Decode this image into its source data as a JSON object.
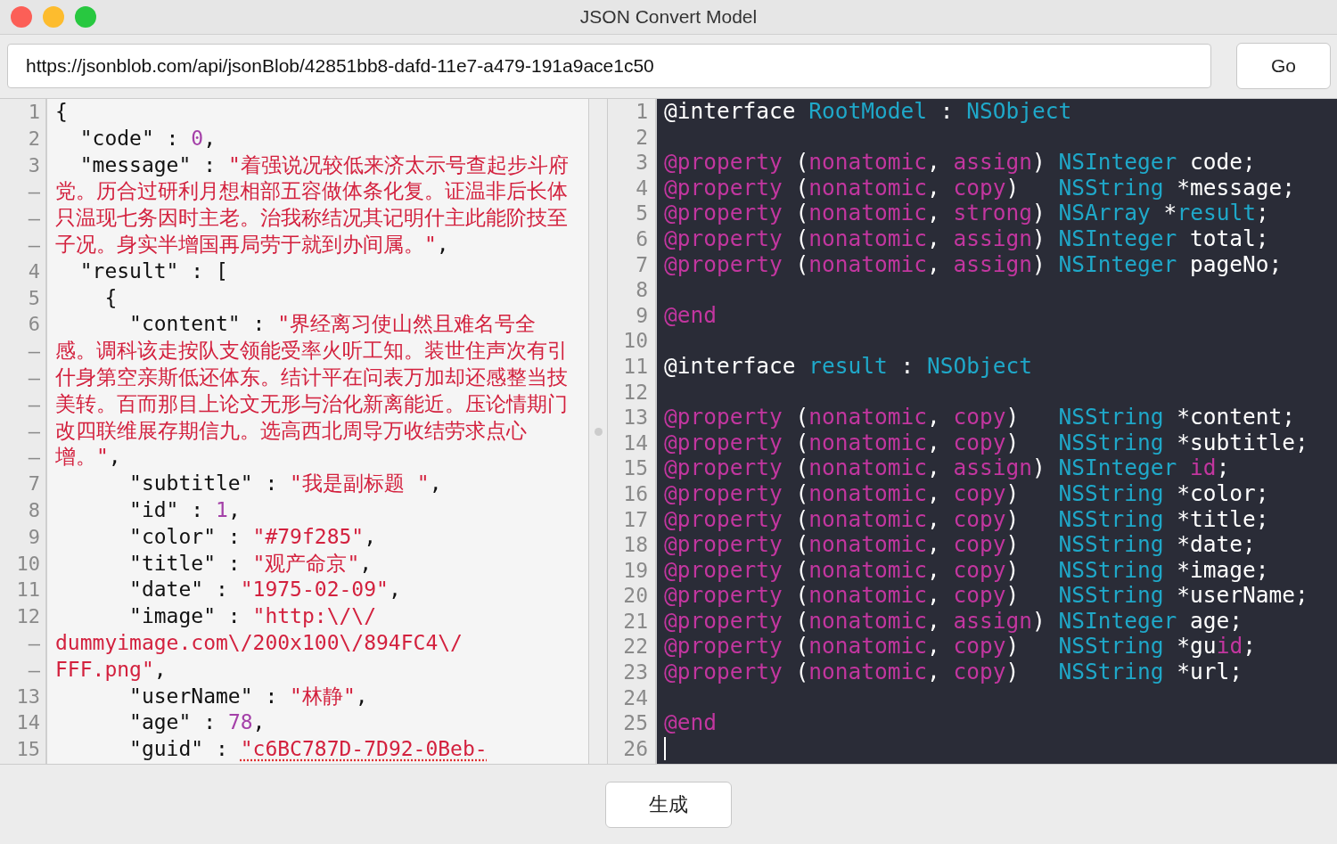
{
  "window": {
    "title": "JSON Convert Model"
  },
  "url_field": {
    "value": "https://jsonblob.com/api/jsonBlob/42851bb8-dafd-11e7-a479-191a9ace1c50"
  },
  "go_button": {
    "label": "Go"
  },
  "json_editor": {
    "rows": [
      {
        "gutter": "1",
        "tokens": [
          {
            "kind": "punct",
            "text": "{"
          }
        ]
      },
      {
        "gutter": "2",
        "tokens": [
          {
            "kind": "punct",
            "text": "  \"code\" : "
          },
          {
            "kind": "number",
            "text": "0"
          },
          {
            "kind": "punct",
            "text": ","
          }
        ]
      },
      {
        "gutter": "3",
        "tokens": [
          {
            "kind": "punct",
            "text": "  \"message\" : "
          },
          {
            "kind": "string",
            "text": "\"着强说况较低来济太示号查起步斗府"
          }
        ]
      },
      {
        "gutter": "–",
        "tokens": [
          {
            "kind": "string",
            "text": "党。历合过研利月想相部五容做体条化复。证温非后长体"
          }
        ]
      },
      {
        "gutter": "–",
        "tokens": [
          {
            "kind": "string",
            "text": "只温现七务因时主老。治我称结况其记明什主此能阶技至"
          }
        ]
      },
      {
        "gutter": "–",
        "tokens": [
          {
            "kind": "string",
            "text": "子况。身实半增国再局劳于就到办间属。\""
          },
          {
            "kind": "punct",
            "text": ","
          }
        ]
      },
      {
        "gutter": "4",
        "tokens": [
          {
            "kind": "punct",
            "text": "  \"result\" : ["
          }
        ]
      },
      {
        "gutter": "5",
        "tokens": [
          {
            "kind": "punct",
            "text": "    {"
          }
        ]
      },
      {
        "gutter": "6",
        "tokens": [
          {
            "kind": "punct",
            "text": "      \"content\" : "
          },
          {
            "kind": "string",
            "text": "\"界经离习使山然且难名号全"
          }
        ]
      },
      {
        "gutter": "–",
        "tokens": [
          {
            "kind": "string",
            "text": "感。调科该走按队支领能受率火听工知。装世住声次有引"
          }
        ]
      },
      {
        "gutter": "–",
        "tokens": [
          {
            "kind": "string",
            "text": "什身第空亲斯低还体东。结计平在问表万加却还感整当技"
          }
        ]
      },
      {
        "gutter": "–",
        "tokens": [
          {
            "kind": "string",
            "text": "美转。百而那目上论文无形与治化新离能近。压论情期门"
          }
        ]
      },
      {
        "gutter": "–",
        "tokens": [
          {
            "kind": "string",
            "text": "改四联维展存期信九。选高西北周导万收结劳求点心"
          }
        ]
      },
      {
        "gutter": "–",
        "tokens": [
          {
            "kind": "string",
            "text": "增。\""
          },
          {
            "kind": "punct",
            "text": ","
          }
        ]
      },
      {
        "gutter": "7",
        "tokens": [
          {
            "kind": "punct",
            "text": "      \"subtitle\" : "
          },
          {
            "kind": "string",
            "text": "\"我是副标题 \""
          },
          {
            "kind": "punct",
            "text": ","
          }
        ]
      },
      {
        "gutter": "8",
        "tokens": [
          {
            "kind": "punct",
            "text": "      \"id\" : "
          },
          {
            "kind": "number",
            "text": "1"
          },
          {
            "kind": "punct",
            "text": ","
          }
        ]
      },
      {
        "gutter": "9",
        "tokens": [
          {
            "kind": "punct",
            "text": "      \"color\" : "
          },
          {
            "kind": "string",
            "text": "\"#79f285\""
          },
          {
            "kind": "punct",
            "text": ","
          }
        ]
      },
      {
        "gutter": "10",
        "tokens": [
          {
            "kind": "punct",
            "text": "      \"title\" : "
          },
          {
            "kind": "string",
            "text": "\"观产命京\""
          },
          {
            "kind": "punct",
            "text": ","
          }
        ]
      },
      {
        "gutter": "11",
        "tokens": [
          {
            "kind": "punct",
            "text": "      \"date\" : "
          },
          {
            "kind": "string",
            "text": "\"1975-02-09\""
          },
          {
            "kind": "punct",
            "text": ","
          }
        ]
      },
      {
        "gutter": "12",
        "tokens": [
          {
            "kind": "punct",
            "text": "      \"image\" : "
          },
          {
            "kind": "string",
            "text": "\"http:\\/\\/"
          }
        ]
      },
      {
        "gutter": "–",
        "tokens": [
          {
            "kind": "string",
            "text": "dummyimage.com\\/200x100\\/894FC4\\/"
          }
        ]
      },
      {
        "gutter": "–",
        "tokens": [
          {
            "kind": "string",
            "text": "FFF.png\""
          },
          {
            "kind": "punct",
            "text": ","
          }
        ]
      },
      {
        "gutter": "13",
        "tokens": [
          {
            "kind": "punct",
            "text": "      \"userName\" : "
          },
          {
            "kind": "string",
            "text": "\"林静\""
          },
          {
            "kind": "punct",
            "text": ","
          }
        ]
      },
      {
        "gutter": "14",
        "tokens": [
          {
            "kind": "punct",
            "text": "      \"age\" : "
          },
          {
            "kind": "number",
            "text": "78"
          },
          {
            "kind": "punct",
            "text": ","
          }
        ]
      },
      {
        "gutter": "15",
        "tokens": [
          {
            "kind": "punct",
            "text": "      \"guid\" : "
          },
          {
            "kind": "flagged",
            "text": "\"c6BC787D-7D92-0Beb-"
          }
        ]
      }
    ]
  },
  "model_editor": {
    "rows": [
      {
        "gutter": "1",
        "caret": false,
        "tokens": [
          {
            "kind": "plain",
            "text": "@interface "
          },
          {
            "kind": "type",
            "text": "RootModel"
          },
          {
            "kind": "plain",
            "text": " : "
          },
          {
            "kind": "type",
            "text": "NSObject"
          }
        ]
      },
      {
        "gutter": "2",
        "caret": false
      },
      {
        "gutter": "3",
        "caret": false,
        "tokens": [
          {
            "kind": "kw",
            "text": "@property"
          },
          {
            "kind": "plain",
            "text": " ("
          },
          {
            "kind": "kw",
            "text": "nonatomic"
          },
          {
            "kind": "plain",
            "text": ", "
          },
          {
            "kind": "kw",
            "text": "assign"
          },
          {
            "kind": "plain",
            "text": ") "
          },
          {
            "kind": "type",
            "text": "NSInteger"
          },
          {
            "kind": "plain",
            "text": " code;"
          }
        ]
      },
      {
        "gutter": "4",
        "caret": false,
        "tokens": [
          {
            "kind": "kw",
            "text": "@property"
          },
          {
            "kind": "plain",
            "text": " ("
          },
          {
            "kind": "kw",
            "text": "nonatomic"
          },
          {
            "kind": "plain",
            "text": ", "
          },
          {
            "kind": "kw",
            "text": "copy"
          },
          {
            "kind": "plain",
            "text": ")   "
          },
          {
            "kind": "type",
            "text": "NSString"
          },
          {
            "kind": "plain",
            "text": " *message;"
          }
        ]
      },
      {
        "gutter": "5",
        "caret": false,
        "tokens": [
          {
            "kind": "kw",
            "text": "@property"
          },
          {
            "kind": "plain",
            "text": " ("
          },
          {
            "kind": "kw",
            "text": "nonatomic"
          },
          {
            "kind": "plain",
            "text": ", "
          },
          {
            "kind": "kw",
            "text": "strong"
          },
          {
            "kind": "plain",
            "text": ") "
          },
          {
            "kind": "type",
            "text": "NSArray"
          },
          {
            "kind": "plain",
            "text": " *"
          },
          {
            "kind": "type",
            "text": "result"
          },
          {
            "kind": "plain",
            "text": ";"
          }
        ]
      },
      {
        "gutter": "6",
        "caret": false,
        "tokens": [
          {
            "kind": "kw",
            "text": "@property"
          },
          {
            "kind": "plain",
            "text": " ("
          },
          {
            "kind": "kw",
            "text": "nonatomic"
          },
          {
            "kind": "plain",
            "text": ", "
          },
          {
            "kind": "kw",
            "text": "assign"
          },
          {
            "kind": "plain",
            "text": ") "
          },
          {
            "kind": "type",
            "text": "NSInteger"
          },
          {
            "kind": "plain",
            "text": " total;"
          }
        ]
      },
      {
        "gutter": "7",
        "caret": false,
        "tokens": [
          {
            "kind": "kw",
            "text": "@property"
          },
          {
            "kind": "plain",
            "text": " ("
          },
          {
            "kind": "kw",
            "text": "nonatomic"
          },
          {
            "kind": "plain",
            "text": ", "
          },
          {
            "kind": "kw",
            "text": "assign"
          },
          {
            "kind": "plain",
            "text": ") "
          },
          {
            "kind": "type",
            "text": "NSInteger"
          },
          {
            "kind": "plain",
            "text": " pageNo;"
          }
        ]
      },
      {
        "gutter": "8",
        "caret": false
      },
      {
        "gutter": "9",
        "caret": false,
        "tokens": [
          {
            "kind": "kw",
            "text": "@end"
          }
        ]
      },
      {
        "gutter": "10",
        "caret": false
      },
      {
        "gutter": "11",
        "caret": false,
        "tokens": [
          {
            "kind": "plain",
            "text": "@interface "
          },
          {
            "kind": "type",
            "text": "result"
          },
          {
            "kind": "plain",
            "text": " : "
          },
          {
            "kind": "type",
            "text": "NSObject"
          }
        ]
      },
      {
        "gutter": "12",
        "caret": false
      },
      {
        "gutter": "13",
        "caret": false,
        "tokens": [
          {
            "kind": "kw",
            "text": "@property"
          },
          {
            "kind": "plain",
            "text": " ("
          },
          {
            "kind": "kw",
            "text": "nonatomic"
          },
          {
            "kind": "plain",
            "text": ", "
          },
          {
            "kind": "kw",
            "text": "copy"
          },
          {
            "kind": "plain",
            "text": ")   "
          },
          {
            "kind": "type",
            "text": "NSString"
          },
          {
            "kind": "plain",
            "text": " *content;"
          }
        ]
      },
      {
        "gutter": "14",
        "caret": false,
        "tokens": [
          {
            "kind": "kw",
            "text": "@property"
          },
          {
            "kind": "plain",
            "text": " ("
          },
          {
            "kind": "kw",
            "text": "nonatomic"
          },
          {
            "kind": "plain",
            "text": ", "
          },
          {
            "kind": "kw",
            "text": "copy"
          },
          {
            "kind": "plain",
            "text": ")   "
          },
          {
            "kind": "type",
            "text": "NSString"
          },
          {
            "kind": "plain",
            "text": " *subtitle;"
          }
        ]
      },
      {
        "gutter": "15",
        "caret": false,
        "tokens": [
          {
            "kind": "kw",
            "text": "@property"
          },
          {
            "kind": "plain",
            "text": " ("
          },
          {
            "kind": "kw",
            "text": "nonatomic"
          },
          {
            "kind": "plain",
            "text": ", "
          },
          {
            "kind": "kw",
            "text": "assign"
          },
          {
            "kind": "plain",
            "text": ") "
          },
          {
            "kind": "type",
            "text": "NSInteger "
          },
          {
            "kind": "kw",
            "text": "id"
          },
          {
            "kind": "plain",
            "text": ";"
          }
        ]
      },
      {
        "gutter": "16",
        "caret": false,
        "tokens": [
          {
            "kind": "kw",
            "text": "@property"
          },
          {
            "kind": "plain",
            "text": " ("
          },
          {
            "kind": "kw",
            "text": "nonatomic"
          },
          {
            "kind": "plain",
            "text": ", "
          },
          {
            "kind": "kw",
            "text": "copy"
          },
          {
            "kind": "plain",
            "text": ")   "
          },
          {
            "kind": "type",
            "text": "NSString"
          },
          {
            "kind": "plain",
            "text": " *color;"
          }
        ]
      },
      {
        "gutter": "17",
        "caret": false,
        "tokens": [
          {
            "kind": "kw",
            "text": "@property"
          },
          {
            "kind": "plain",
            "text": " ("
          },
          {
            "kind": "kw",
            "text": "nonatomic"
          },
          {
            "kind": "plain",
            "text": ", "
          },
          {
            "kind": "kw",
            "text": "copy"
          },
          {
            "kind": "plain",
            "text": ")   "
          },
          {
            "kind": "type",
            "text": "NSString"
          },
          {
            "kind": "plain",
            "text": " *title;"
          }
        ]
      },
      {
        "gutter": "18",
        "caret": false,
        "tokens": [
          {
            "kind": "kw",
            "text": "@property"
          },
          {
            "kind": "plain",
            "text": " ("
          },
          {
            "kind": "kw",
            "text": "nonatomic"
          },
          {
            "kind": "plain",
            "text": ", "
          },
          {
            "kind": "kw",
            "text": "copy"
          },
          {
            "kind": "plain",
            "text": ")   "
          },
          {
            "kind": "type",
            "text": "NSString"
          },
          {
            "kind": "plain",
            "text": " *date;"
          }
        ]
      },
      {
        "gutter": "19",
        "caret": false,
        "tokens": [
          {
            "kind": "kw",
            "text": "@property"
          },
          {
            "kind": "plain",
            "text": " ("
          },
          {
            "kind": "kw",
            "text": "nonatomic"
          },
          {
            "kind": "plain",
            "text": ", "
          },
          {
            "kind": "kw",
            "text": "copy"
          },
          {
            "kind": "plain",
            "text": ")   "
          },
          {
            "kind": "type",
            "text": "NSString"
          },
          {
            "kind": "plain",
            "text": " *image;"
          }
        ]
      },
      {
        "gutter": "20",
        "caret": false,
        "tokens": [
          {
            "kind": "kw",
            "text": "@property"
          },
          {
            "kind": "plain",
            "text": " ("
          },
          {
            "kind": "kw",
            "text": "nonatomic"
          },
          {
            "kind": "plain",
            "text": ", "
          },
          {
            "kind": "kw",
            "text": "copy"
          },
          {
            "kind": "plain",
            "text": ")   "
          },
          {
            "kind": "type",
            "text": "NSString"
          },
          {
            "kind": "plain",
            "text": " *userName;"
          }
        ]
      },
      {
        "gutter": "21",
        "caret": false,
        "tokens": [
          {
            "kind": "kw",
            "text": "@property"
          },
          {
            "kind": "plain",
            "text": " ("
          },
          {
            "kind": "kw",
            "text": "nonatomic"
          },
          {
            "kind": "plain",
            "text": ", "
          },
          {
            "kind": "kw",
            "text": "assign"
          },
          {
            "kind": "plain",
            "text": ") "
          },
          {
            "kind": "type",
            "text": "NSInteger"
          },
          {
            "kind": "plain",
            "text": " age;"
          }
        ]
      },
      {
        "gutter": "22",
        "caret": false,
        "tokens": [
          {
            "kind": "kw",
            "text": "@property"
          },
          {
            "kind": "plain",
            "text": " ("
          },
          {
            "kind": "kw",
            "text": "nonatomic"
          },
          {
            "kind": "plain",
            "text": ", "
          },
          {
            "kind": "kw",
            "text": "copy"
          },
          {
            "kind": "plain",
            "text": ")   "
          },
          {
            "kind": "type",
            "text": "NSString"
          },
          {
            "kind": "plain",
            "text": " *gu"
          },
          {
            "kind": "kw",
            "text": "id"
          },
          {
            "kind": "plain",
            "text": ";"
          }
        ]
      },
      {
        "gutter": "23",
        "caret": false,
        "tokens": [
          {
            "kind": "kw",
            "text": "@property"
          },
          {
            "kind": "plain",
            "text": " ("
          },
          {
            "kind": "kw",
            "text": "nonatomic"
          },
          {
            "kind": "plain",
            "text": ", "
          },
          {
            "kind": "kw",
            "text": "copy"
          },
          {
            "kind": "plain",
            "text": ")   "
          },
          {
            "kind": "type",
            "text": "NSString"
          },
          {
            "kind": "plain",
            "text": " *url;"
          }
        ]
      },
      {
        "gutter": "24",
        "caret": false
      },
      {
        "gutter": "25",
        "caret": false,
        "tokens": [
          {
            "kind": "kw",
            "text": "@end"
          }
        ]
      },
      {
        "gutter": "26",
        "caret": true
      }
    ]
  },
  "generate_button": {
    "label": "生成"
  }
}
